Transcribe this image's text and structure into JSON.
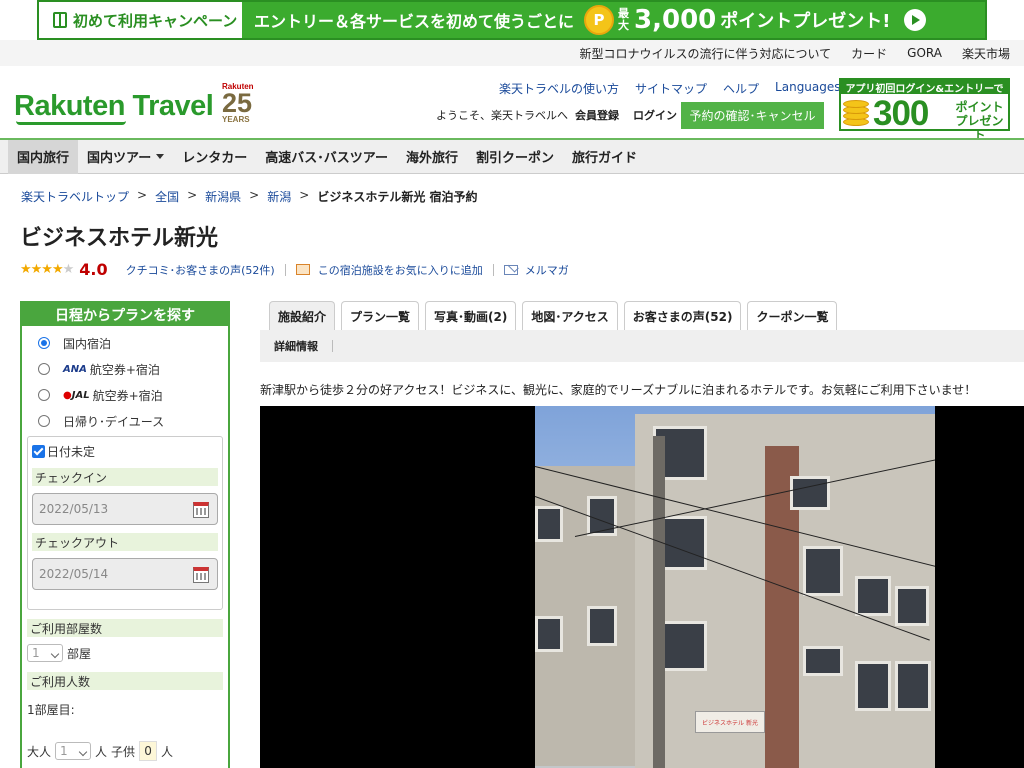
{
  "promo": {
    "first_label": "初めて利用キャンペーン",
    "message": "エントリー＆各サービスを初めて使うごとに",
    "coin": "P",
    "max": "最大",
    "amount": "3,000",
    "rest": "ポイントプレゼント!"
  },
  "toplinks": [
    "新型コロナウイルスの流行に伴う対応について",
    "カード",
    "GORA",
    "楽天市場"
  ],
  "header": {
    "logo": "Rakuten Travel",
    "anniv_brand": "Rakuten",
    "anniv_num": "25",
    "anniv_years": "YEARS",
    "nav": [
      "楽天トラベルの使い方",
      "サイトマップ",
      "ヘルプ"
    ],
    "languages": "Languages",
    "welcome": "ようこそ、楽天トラベルへ",
    "register": "会員登録",
    "login": "ログイン",
    "reserve_button": "予約の確認･キャンセル",
    "app_head": "アプリ初回ログイン&エントリーで",
    "app_num": "300",
    "app_pt1": "ポイント",
    "app_pt2": "プレゼント"
  },
  "gnav": [
    "国内旅行",
    "国内ツアー",
    "レンタカー",
    "高速バス･バスツアー",
    "海外旅行",
    "割引クーポン",
    "旅行ガイド"
  ],
  "breadcrumb": {
    "items": [
      "楽天トラベルトップ",
      "全国",
      "新潟県",
      "新潟"
    ],
    "sep": ">",
    "current": "ビジネスホテル新光 宿泊予約"
  },
  "hotel": {
    "name": "ビジネスホテル新光",
    "rating": 4.0,
    "rating_text": "4.0",
    "reviews_link": "クチコミ･お客さまの声(52件)",
    "favorite_link": "この宿泊施設をお気に入りに追加",
    "mail_link": "メルマガ",
    "description": "新津駅から徒歩２分の好アクセス！ビジネスに、観光に、家庭的でリーズナブルに泊まれるホテルです。お気軽にご利用下さいませ！"
  },
  "sidebar": {
    "title": "日程からプランを探す",
    "options": [
      {
        "prefix": "",
        "label": "国内宿泊",
        "selected": true
      },
      {
        "prefix": "ANA",
        "label": "航空券+宿泊",
        "selected": false
      },
      {
        "prefix": "JAL",
        "label": "航空券+宿泊",
        "selected": false
      },
      {
        "prefix": "",
        "label": "日帰り･デイユース",
        "selected": false
      }
    ],
    "undecided": "日付未定",
    "checkin_label": "チェックイン",
    "checkin_value": "2022/05/13",
    "checkout_label": "チェックアウト",
    "checkout_value": "2022/05/14",
    "rooms_label": "ご利用部屋数",
    "rooms_value": "1",
    "rooms_unit": "部屋",
    "guests_label": "ご利用人数",
    "room1": "1部屋目:",
    "adult_label": "大人",
    "adult_value": "1",
    "person_unit": "人",
    "child_label": "子供",
    "child_value": "0"
  },
  "tabs": [
    "施設紹介",
    "プラン一覧",
    "写真･動画(2)",
    "地図･アクセス",
    "お客さまの声(52)",
    "クーポン一覧"
  ],
  "subtab": "詳細情報",
  "photo_sign": "ビジネスホテル 新光"
}
